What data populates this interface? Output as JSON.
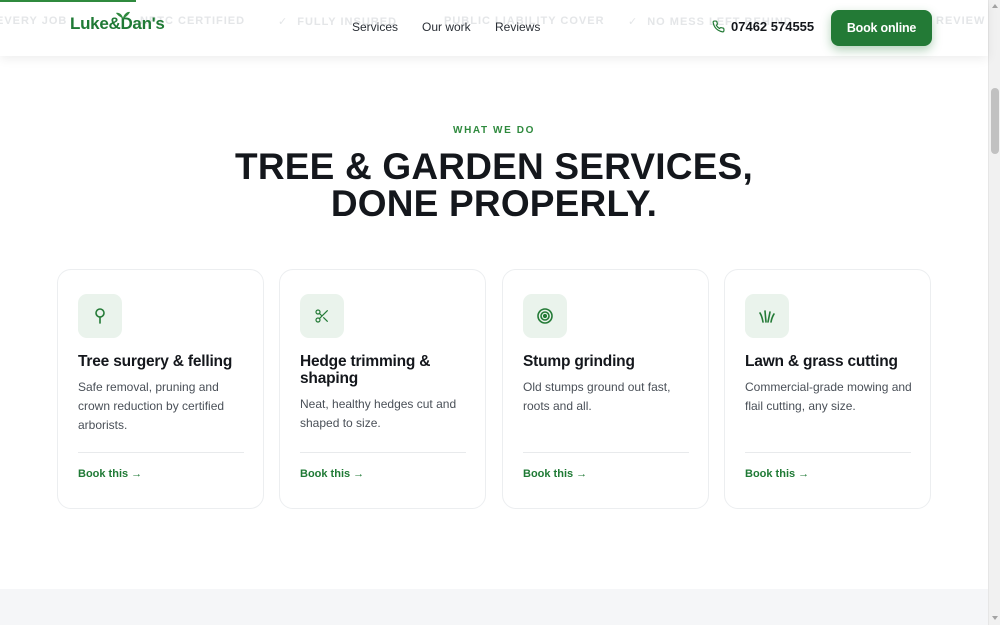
{
  "ticker": {
    "items": [
      {
        "text": "EVERY JOB",
        "check": false
      },
      {
        "text": "NPTC CERTIFIED",
        "check": false
      },
      {
        "text": "FULLY INSURED",
        "check": true
      },
      {
        "text": "PUBLIC LIABILITY COVER",
        "check": false
      },
      {
        "text": "NO MESS LEFT BEHIND",
        "check": true
      },
      {
        "text": "REVIEW",
        "check": false
      }
    ]
  },
  "header": {
    "logo_text": "Luke&Dan's",
    "nav": [
      "Services",
      "Our work",
      "Reviews"
    ],
    "phone": "07462 574555",
    "book_label": "Book online"
  },
  "section": {
    "eyebrow": "WHAT WE DO",
    "headline_line1": "TREE & GARDEN SERVICES,",
    "headline_line2": "DONE PROPERLY."
  },
  "cards": [
    {
      "icon": "tree-icon",
      "title": "Tree surgery & felling",
      "description": "Safe removal, pruning and crown reduction by certified arborists.",
      "link": "Book this →"
    },
    {
      "icon": "scissors-icon",
      "title": "Hedge trimming & shaping",
      "description": "Neat, healthy hedges cut and shaped to size.",
      "link": "Book this →"
    },
    {
      "icon": "target-icon",
      "title": "Stump grinding",
      "description": "Old stumps ground out fast, roots and all.",
      "link": "Book this →"
    },
    {
      "icon": "grass-icon",
      "title": "Lawn & grass cutting",
      "description": "Commercial-grade mowing and flail cutting, any size.",
      "link": "Book this →"
    }
  ],
  "colors": {
    "brand_green": "#237a36",
    "accent_green": "#2f8a3e",
    "icon_bg": "#eaf3ec",
    "text_dark": "#14171c"
  }
}
